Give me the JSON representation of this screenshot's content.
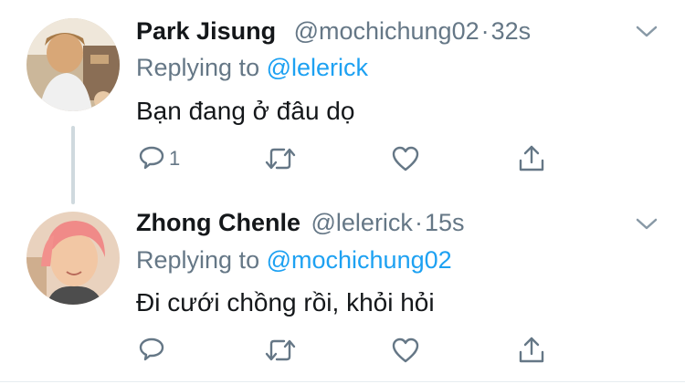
{
  "tweets": [
    {
      "name": "Park Jisung",
      "handle": "@mochichung02",
      "separator": "·",
      "time": "32s",
      "replying_prefix": "Replying to",
      "replying_to": "@lelerick",
      "text": "Bạn đang ở đâu dọ",
      "reply_count": "1"
    },
    {
      "name": "Zhong Chenle",
      "handle": "@lelerick",
      "separator": "·",
      "time": "15s",
      "replying_prefix": "Replying to",
      "replying_to": "@mochichung02",
      "text": "Đi cưới chồng rồi, khỏi hỏi",
      "reply_count": ""
    }
  ],
  "icons": {
    "reply": "reply-icon",
    "retweet": "retweet-icon",
    "like": "heart-icon",
    "share": "share-icon",
    "more": "chevron-down-icon"
  },
  "colors": {
    "name": "#14171a",
    "secondary": "#657786",
    "mention": "#1da1f2",
    "thread_line": "#cfd9de"
  }
}
